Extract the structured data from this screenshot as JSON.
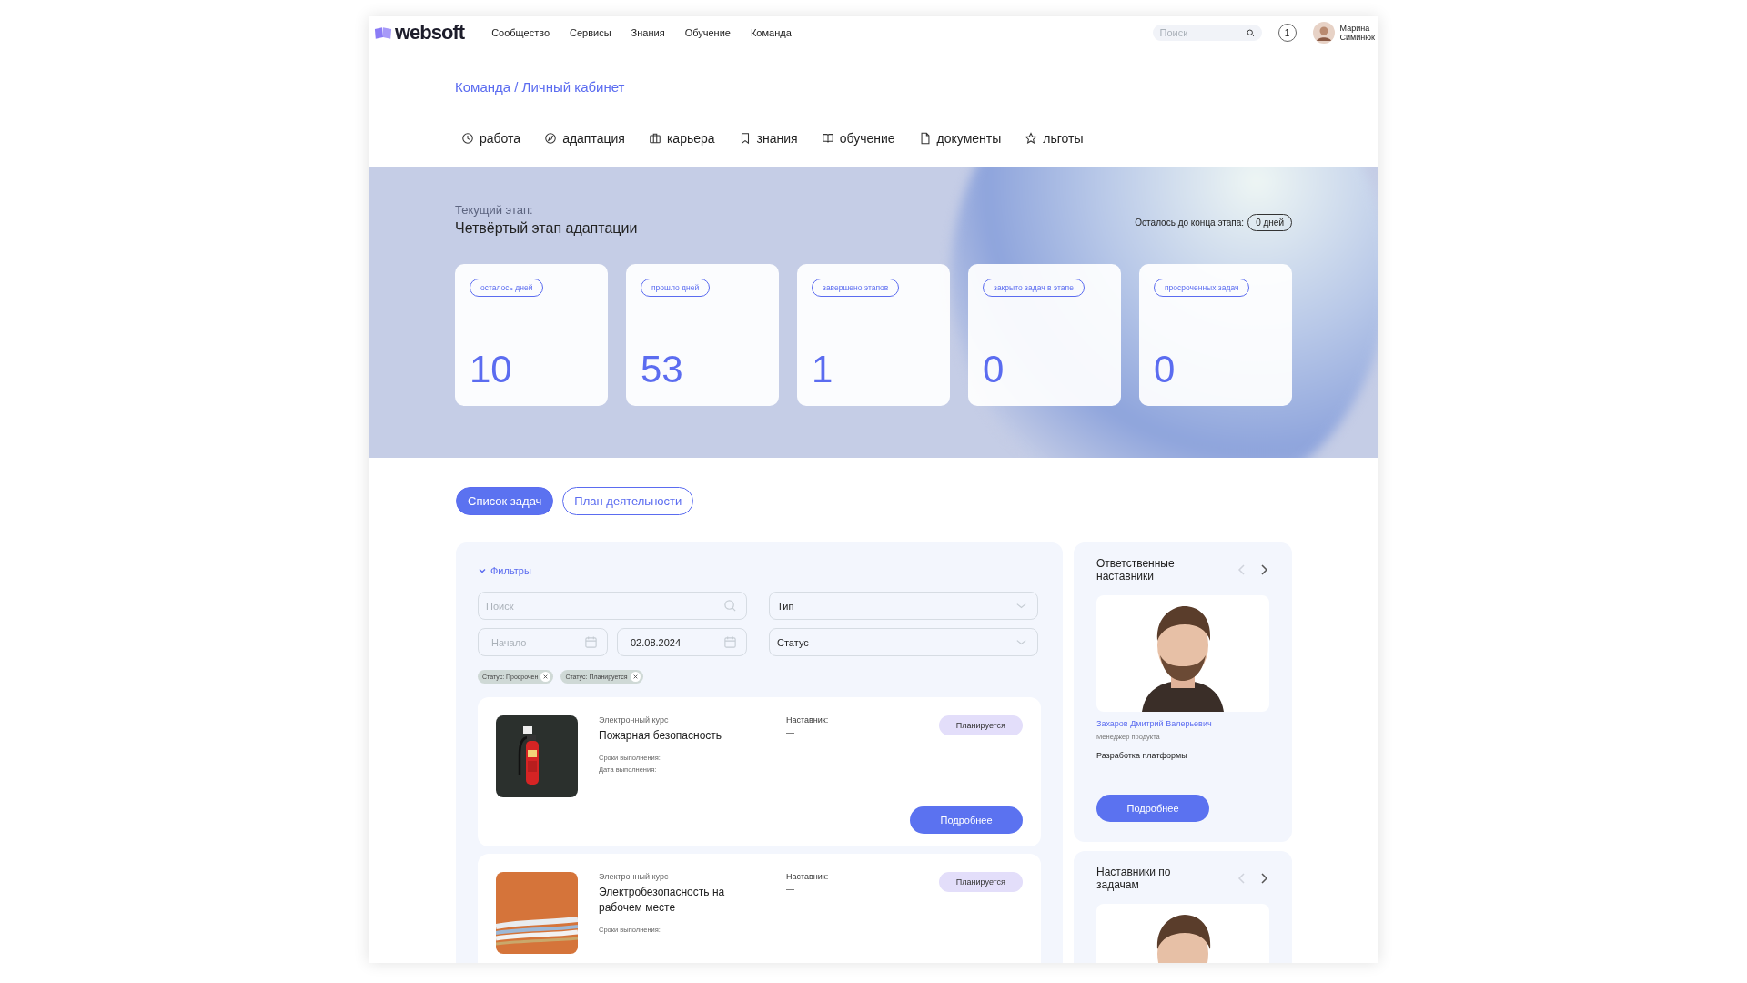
{
  "header": {
    "logo": "websoft",
    "nav": [
      "Сообщество",
      "Сервисы",
      "Знания",
      "Обучение",
      "Команда"
    ],
    "search": {
      "placeholder": "Поиск"
    },
    "notifications": "1",
    "user": {
      "first_name": "Марина",
      "last_name": "Симинюк"
    }
  },
  "breadcrumb": "Команда / Личный кабинет",
  "tabs": [
    {
      "label": "работа",
      "kind": "clock"
    },
    {
      "label": "адаптация",
      "kind": "compass"
    },
    {
      "label": "карьера",
      "kind": "briefcase"
    },
    {
      "label": "знания",
      "kind": "bookmark"
    },
    {
      "label": "обучение",
      "kind": "book"
    },
    {
      "label": "документы",
      "kind": "document"
    },
    {
      "label": "льготы",
      "kind": "star"
    }
  ],
  "stage": {
    "caption": "Текущий этап:",
    "title": "Четвёртый этап адаптации",
    "remaining_label": "Осталось до конца этапа:",
    "remaining_value": "0 дней"
  },
  "stats": [
    {
      "label": "осталось дней",
      "value": "10"
    },
    {
      "label": "прошло дней",
      "value": "53"
    },
    {
      "label": "завершено этапов",
      "value": "1"
    },
    {
      "label": "закрыто задач в этапе",
      "value": "0"
    },
    {
      "label": "просроченных задач",
      "value": "0"
    }
  ],
  "views": [
    {
      "label": "Список задач",
      "selected": true
    },
    {
      "label": "План деятельности",
      "selected": false
    }
  ],
  "filters": {
    "title": "Фильтры",
    "expanded": true,
    "search": {
      "placeholder": "Поиск"
    },
    "type": {
      "value": "Тип"
    },
    "start": {
      "placeholder": "Начало"
    },
    "end": {
      "value": "02.08.2024"
    },
    "status": {
      "value": "Статус"
    },
    "chips": [
      "Статус: Просрочен",
      "Статус: Планируется"
    ]
  },
  "tasks": [
    {
      "type": "Электронный курс",
      "title": "Пожарная безопасность",
      "kind": "extinguisher",
      "details": [
        "Сроки выполнения:",
        "Дата выполнения:"
      ],
      "mentor_label": "Наставник:",
      "mentor": "—",
      "status": "Планируется",
      "button": "Подробнее"
    },
    {
      "type": "Электронный курс",
      "title": "Электробезопасность на рабочем месте",
      "kind": "cables",
      "details": [
        "Сроки выполнения:"
      ],
      "mentor_label": "Наставник:",
      "mentor": "—",
      "status": "Планируется"
    }
  ],
  "mentor_panels": [
    {
      "title": "Ответственные наставники",
      "arrows": [
        {
          "kind": "prev",
          "disabled": true
        },
        {
          "kind": "next",
          "disabled": false
        }
      ],
      "mentor": {
        "name": "Захаров Дмитрий Валерьевич",
        "role": "Менеджер продукта",
        "department": "Разработка платформы",
        "button": "Подробнее"
      }
    },
    {
      "title": "Наставники по задачам",
      "arrows": [
        {
          "kind": "prev",
          "disabled": true
        },
        {
          "kind": "next",
          "disabled": false
        }
      ]
    }
  ]
}
